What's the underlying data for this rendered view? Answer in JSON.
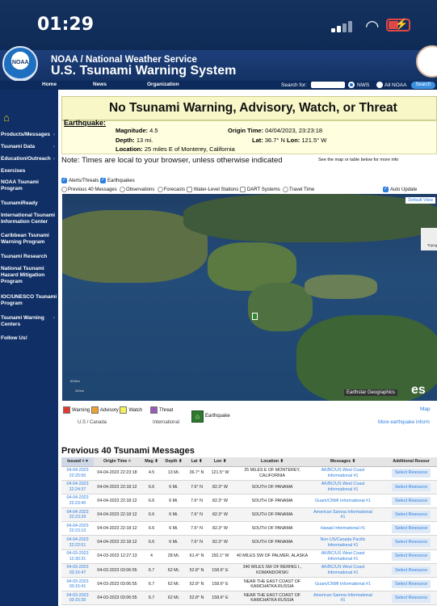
{
  "status": {
    "time": "01:29"
  },
  "header": {
    "agency": "NOAA / National Weather Service",
    "system": "U.S. Tsunami Warning System",
    "logo_text": "NOAA"
  },
  "nav": {
    "items": [
      "Home",
      "News",
      "Organization"
    ],
    "search_label": "Search for:",
    "radio_nws": "NWS",
    "radio_all": "All NOAA",
    "search_button": "Search"
  },
  "sidebar": {
    "items": [
      "Products/Messages",
      "Tsunami Data",
      "Education/Outreach",
      "Exercises",
      "NOAA Tsunami Program",
      "TsunamiReady",
      "International Tsunami Information Center",
      "Caribbean Tsunami Warning Program",
      "Tsunami Research",
      "National Tsunami Hazard Mitigation Program",
      "IOC/UNESCO Tsunami Program",
      "Tsunami Warning Centers",
      "Follow Us!"
    ]
  },
  "banner": {
    "title": "No Tsunami Warning, Advisory, Watch, or Threat"
  },
  "earthquake": {
    "label": "Earthquake:",
    "magnitude_label": "Magnitude:",
    "magnitude": "4.5",
    "depth_label": "Depth:",
    "depth": "13 mi.",
    "location_label": "Location:",
    "location": "25 miles E of Monterey, California",
    "origin_label": "Origin Time:",
    "origin": "04/04/2023, 23:23:18",
    "lat_label": "Lat:",
    "lat": "36.7° N",
    "lon_label": "Lon:",
    "lon": "121.5° W"
  },
  "note": {
    "text": "Note: Times are local to your browser, unless otherwise indicated",
    "see_map": "See the map or table below for more info"
  },
  "filters": {
    "alerts": "Alerts/Threats",
    "earthquakes": "Earthquakes",
    "prev40": "Previous 40 Messages",
    "observations": "Observations",
    "forecasts": "Forecasts",
    "water": "Water-Level Stations",
    "dart": "DART Systems",
    "travel": "Travel Time",
    "auto_update": "Auto Update"
  },
  "map": {
    "default_view": "Default View",
    "topo": "Topog",
    "credit": "Earthstar Geographics",
    "esri": "es",
    "scale1": "600km",
    "scale2": "300mi",
    "powered": "POWE"
  },
  "legend": {
    "warning": "Warning",
    "advisory": "Advisory",
    "watch": "Watch",
    "threat": "Threat",
    "us_canada": "U.S / Canada",
    "international": "International",
    "earthquake": "Earthquake",
    "map_link": "Map",
    "more_info": "More earthquake inform",
    "colors": {
      "warning": "#e03a2f",
      "advisory": "#f0a030",
      "watch": "#f7ef58",
      "threat": "#9b59b6"
    }
  },
  "table": {
    "title": "Previous 40 Tsunami Messages",
    "headers": [
      "Issued ˄ ▾",
      "Origin Time ˄",
      "Mag ⬍",
      "Depth ⬍",
      "Lat ⬍",
      "Lon ⬍",
      "Location ⬍",
      "Messages ⬍",
      "Additional Resour"
    ],
    "rows": [
      [
        "04-04-2023 22:25:56",
        "04-04-2023 22:23:18",
        "4.5",
        "13 Mi.",
        "36.7° N",
        "121.5° W",
        "25 MILES E OF MONTEREY, CALIFORNIA",
        "AK/BC/US West Coast Informational #1",
        "Select Resource"
      ],
      [
        "04-04-2023 22:24:37",
        "04-04-2023 22:18:12",
        "6.6",
        "6 Mi.",
        "7.6° N",
        "82.3° W",
        "SOUTH OF PANAMA",
        "AK/BC/US West Coast Informational #1",
        "Select Resource"
      ],
      [
        "04-04-2023 22:23:40",
        "04-04-2023 22:18:12",
        "6.6",
        "6 Mi.",
        "7.6° N",
        "82.3° W",
        "SOUTH OF PANAMA",
        "Guam/CNMI Informational #1",
        "Select Resource"
      ],
      [
        "04-04-2023 22:23:29",
        "04-04-2023 22:18:12",
        "6.6",
        "6 Mi.",
        "7.6° N",
        "82.3° W",
        "SOUTH OF PANAMA",
        "American Samoa Informational #1",
        "Select Resource"
      ],
      [
        "04-04-2023 22:23:10",
        "04-04-2023 22:18:12",
        "6.6",
        "6 Mi.",
        "7.6° N",
        "82.3° W",
        "SOUTH OF PANAMA",
        "Hawaii Informational #1",
        "Select Resource"
      ],
      [
        "04-04-2023 22:22:51",
        "04-04-2023 22:18:12",
        "6.6",
        "6 Mi.",
        "7.6° N",
        "82.3° W",
        "SOUTH OF PANAMA",
        "Non-US/Canada Pacific Informational #1",
        "Select Resource"
      ],
      [
        "04-03-2023 12:30:31",
        "04-03-2023 12:27:13",
        "4",
        "28 Mi.",
        "61.4° N",
        "150.1° W",
        "40 MILES SW OF PALMER, ALASKA",
        "AK/BC/US West Coast Informational #1",
        "Select Resource"
      ],
      [
        "04-03-2023 03:16:47",
        "04-03-2023 03:06:55",
        "6.7",
        "62 Mi.",
        "52.8° N",
        "158.6° E",
        "340 MILES SW OF BERING I., KOMANDORSKI",
        "AK/BC/US West Coast Informational #1",
        "Select Resource"
      ],
      [
        "04-03-2023 03:15:41",
        "04-03-2023 03:06:55",
        "6.7",
        "62 Mi.",
        "52.8° N",
        "158.6° E",
        "NEAR THE EAST COAST OF KAMCHATKA RUSSIA",
        "Guam/CNMI Informational #1",
        "Select Resource"
      ],
      [
        "04-03-2023 03:15:30",
        "04-03-2023 03:06:55",
        "6.7",
        "62 Mi.",
        "52.8° N",
        "158.6° E",
        "NEAR THE EAST COAST OF KAMCHATKA RUSSIA",
        "American Samoa Informational #1",
        "Select Resource"
      ]
    ]
  }
}
